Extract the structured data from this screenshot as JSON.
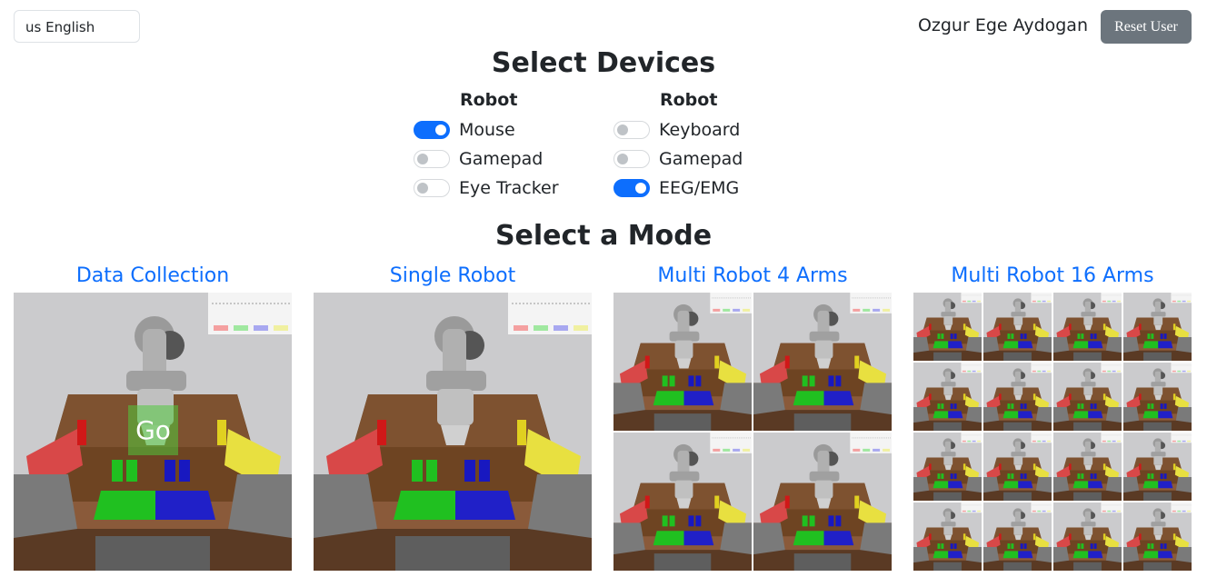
{
  "language": {
    "selected": "us English"
  },
  "user": {
    "name": "Ozgur Ege Aydogan",
    "reset_label": "Reset User"
  },
  "devices": {
    "title": "Select Devices",
    "columns": [
      {
        "header": "Robot",
        "items": [
          {
            "label": "Mouse",
            "on": true
          },
          {
            "label": "Gamepad",
            "on": false
          },
          {
            "label": "Eye Tracker",
            "on": false
          }
        ]
      },
      {
        "header": "Robot",
        "items": [
          {
            "label": "Keyboard",
            "on": false
          },
          {
            "label": "Gamepad",
            "on": false
          },
          {
            "label": "EEG/EMG",
            "on": true
          }
        ]
      }
    ]
  },
  "modes": {
    "title": "Select a Mode",
    "items": [
      {
        "title": "Data Collection",
        "tiles": 1,
        "overlay": "Go"
      },
      {
        "title": "Single Robot",
        "tiles": 1
      },
      {
        "title": "Multi Robot 4 Arms",
        "tiles": 2
      },
      {
        "title": "Multi Robot 16 Arms",
        "tiles": 4
      }
    ]
  },
  "colors": {
    "accent": "#0d6efd",
    "secondary": "#6c757d",
    "text": "#212529"
  }
}
